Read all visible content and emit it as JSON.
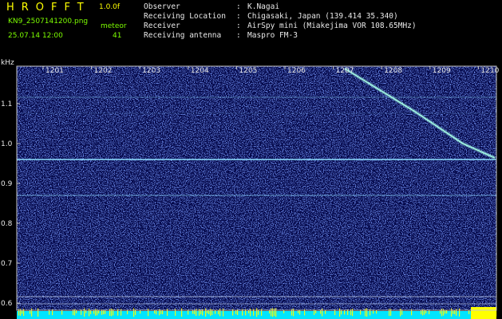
{
  "header": {
    "app_title": "HROFFT",
    "version": "1.0.0f",
    "filename": "KN9_2507141200.png",
    "mode_label": "meteor",
    "datetime": "25.07.14 12:00",
    "count": "41"
  },
  "station": {
    "rows": [
      {
        "label": "Observer",
        "value": "K.Nagai"
      },
      {
        "label": "Receiving Location",
        "value": "Chigasaki, Japan (139.414 35.340)"
      },
      {
        "label": "Receiver",
        "value": "AirSpy mini (Miakejima VOR 108.65MHz)"
      },
      {
        "label": "Receiving antenna",
        "value": "Maspro FM-3"
      }
    ]
  },
  "spectrogram": {
    "freq_unit": "kHz",
    "time_ticks": [
      "1201",
      "1202",
      "1203",
      "1204",
      "1205",
      "1206",
      "1207",
      "1208",
      "1209",
      "1210"
    ],
    "freq_ticks": [
      "1.1",
      "1.0",
      "0.9",
      "0.8",
      "0.7",
      "0.6"
    ],
    "colors": {
      "background": "#04084a",
      "noise": "#2a44d8",
      "carrier": "#8fe0ff",
      "meteor": "#a6ffe8",
      "level_bar": "#00e5ff",
      "level_peak": "#ffff00"
    }
  }
}
